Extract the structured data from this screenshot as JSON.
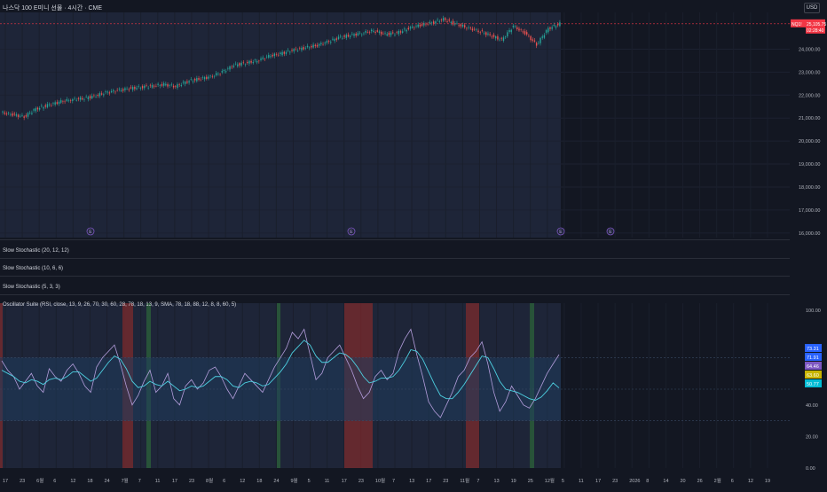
{
  "header": {
    "title": "나스닥 100 E미니 선물 · 4시간 · CME",
    "currency": "USD"
  },
  "panes": {
    "stoch1": "Slow Stochastic (20, 12, 12)",
    "stoch2": "Slow Stochastic (10, 6, 6)",
    "stoch3": "Slow Stochastic (5, 3, 3)",
    "osc": "Oscillator Suite (RSI, close, 13, 9, 26, 70, 30, 60, 28, 78, 18, 13, 9, SMA, 78, 18, 88, 12, 8, 8, 60, 5)"
  },
  "price_axis": {
    "ticks": [
      "24,000.00",
      "23,000.00",
      "22,000.00",
      "21,000.00",
      "20,000.00",
      "19,000.00",
      "18,000.00",
      "17,000.00",
      "16,000.00"
    ],
    "last_price_label": "25,105.75",
    "symbol_badge": "NQ1!",
    "countdown": "02:28:40"
  },
  "osc_axis": {
    "ticks": [
      "100.00",
      "60.00",
      "40.00",
      "20.00",
      "0.00"
    ],
    "badges": [
      {
        "text": "73.31",
        "color": "#2962ff"
      },
      {
        "text": "71.91",
        "color": "#2962ff"
      },
      {
        "text": "64.46",
        "color": "#7e57c2"
      },
      {
        "text": "63.60",
        "color": "#c8b400"
      },
      {
        "text": "50.77",
        "color": "#00bcd4"
      }
    ]
  },
  "time_axis": [
    "17",
    "23",
    "6월",
    "6",
    "12",
    "18",
    "24",
    "7월",
    "7",
    "11",
    "17",
    "23",
    "8월",
    "6",
    "12",
    "18",
    "24",
    "9월",
    "5",
    "11",
    "17",
    "23",
    "10월",
    "7",
    "13",
    "17",
    "23",
    "11월",
    "7",
    "13",
    "19",
    "25",
    "12월",
    "5",
    "11",
    "17",
    "23",
    "2026",
    "8",
    "14",
    "20",
    "26",
    "2월",
    "6",
    "12",
    "19"
  ],
  "event_markers": [
    "E",
    "E",
    "E",
    "E"
  ],
  "colors": {
    "background": "#131722",
    "highlight": "#1e2538",
    "up": "#26a69a",
    "down": "#ef5350",
    "rsi_line": "#b39ddb",
    "signal_line": "#4dd0e1",
    "band": "#1f3d5c",
    "red_zone": "#8b2b2b",
    "green_zone": "#2e6b3a",
    "price_line": "#f23645"
  },
  "chart_data": {
    "type": "line",
    "title": "나스닥 100 E미니 선물 · 4시간 · CME",
    "series": [
      {
        "name": "NQ1!",
        "values": [
          21250,
          21150,
          21060,
          21400,
          21550,
          21700,
          21800,
          21850,
          21950,
          22100,
          22200,
          22280,
          22350,
          22400,
          22460,
          22380,
          22600,
          22700,
          22800,
          23000,
          23300,
          23400,
          23500,
          23700,
          23800,
          23950,
          24050,
          24150,
          24300,
          24500,
          24600,
          24700,
          24800,
          24650,
          24700,
          24900,
          25050,
          25150,
          25300,
          25100,
          24950,
          24800,
          24600,
          24400,
          25000,
          24700,
          24200,
          24900,
          25105
        ]
      }
    ],
    "ylim": [
      15800,
      25600
    ],
    "oscillator": {
      "ylim": [
        0,
        100
      ],
      "bands": [
        30,
        70
      ],
      "rsi": [
        68,
        62,
        58,
        50,
        55,
        60,
        52,
        48,
        63,
        58,
        55,
        62,
        66,
        60,
        52,
        48,
        64,
        70,
        74,
        78,
        66,
        52,
        40,
        46,
        55,
        62,
        48,
        52,
        60,
        44,
        40,
        52,
        56,
        50,
        54,
        62,
        64,
        58,
        50,
        44,
        52,
        60,
        56,
        52,
        48,
        56,
        64,
        70,
        76,
        86,
        82,
        88,
        72,
        56,
        60,
        70,
        74,
        78,
        70,
        62,
        52,
        44,
        48,
        58,
        62,
        56,
        60,
        74,
        82,
        88,
        72,
        58,
        42,
        36,
        32,
        40,
        48,
        58,
        62,
        70,
        74,
        80,
        66,
        48,
        36,
        42,
        52,
        46,
        40,
        38,
        44,
        52,
        60,
        66,
        71.9
      ],
      "signal": [
        62,
        60,
        58,
        55,
        54,
        56,
        55,
        53,
        56,
        57,
        56,
        58,
        61,
        61,
        58,
        55,
        57,
        62,
        67,
        71,
        69,
        63,
        55,
        51,
        52,
        55,
        53,
        52,
        55,
        52,
        49,
        50,
        52,
        51,
        52,
        55,
        58,
        58,
        56,
        52,
        51,
        54,
        55,
        54,
        52,
        53,
        57,
        61,
        66,
        73,
        77,
        81,
        78,
        71,
        67,
        67,
        70,
        73,
        72,
        69,
        64,
        58,
        54,
        55,
        57,
        57,
        58,
        62,
        68,
        75,
        74,
        69,
        61,
        53,
        46,
        44,
        44,
        48,
        53,
        59,
        65,
        71,
        70,
        63,
        55,
        50,
        49,
        48,
        46,
        44,
        43,
        45,
        49,
        54,
        50.8
      ]
    }
  }
}
